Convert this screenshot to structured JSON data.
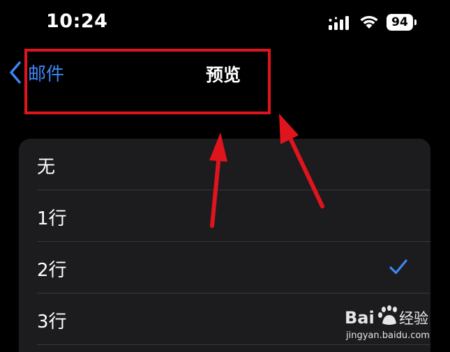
{
  "status_bar": {
    "time": "10:24",
    "battery_level": "94",
    "icons": [
      "cellular-signal-icon",
      "wifi-icon",
      "battery-icon"
    ]
  },
  "nav": {
    "back_label": "邮件",
    "title": "预览",
    "accent_color": "#3d86f5"
  },
  "preview_options": {
    "items": [
      {
        "label": "无",
        "selected": false
      },
      {
        "label": "1行",
        "selected": false
      },
      {
        "label": "2行",
        "selected": true
      },
      {
        "label": "3行",
        "selected": false
      }
    ]
  },
  "annotation": {
    "color": "#e0141c"
  },
  "watermark": {
    "brand": "Baidu经验",
    "url": "jingyan.baidu.com"
  }
}
